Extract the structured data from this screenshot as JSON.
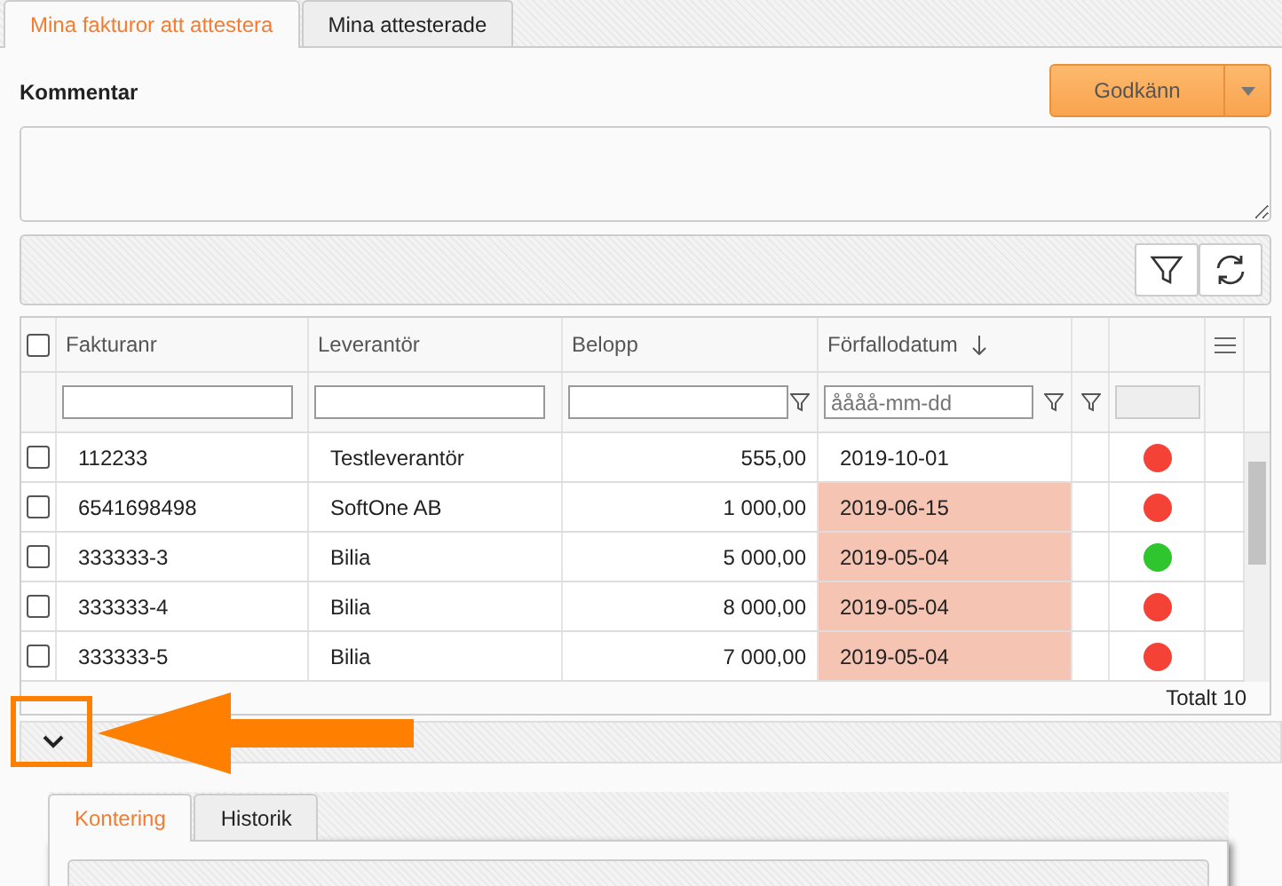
{
  "tabs": [
    {
      "label": "Mina fakturor att attestera",
      "selected": true
    },
    {
      "label": "Mina attesterade",
      "selected": false
    }
  ],
  "comment": {
    "label": "Kommentar"
  },
  "approve_button": {
    "label": "Godkänn"
  },
  "grid": {
    "columns": [
      "Fakturanr",
      "Leverantör",
      "Belopp",
      "Förfallodatum"
    ],
    "all_checked": false,
    "date_filter": {
      "placeholder": "åååå-mm-dd"
    },
    "rows": [
      {
        "invoice": "112233",
        "supplier": "Testleverantör",
        "amount": "555,00",
        "due": "2019-10-01",
        "overdue": false,
        "color": "#f44336",
        "checked": false
      },
      {
        "invoice": "6541698498",
        "supplier": "SoftOne AB",
        "amount": "1 000,00",
        "due": "2019-06-15",
        "overdue": true,
        "color": "#f44336",
        "checked": false
      },
      {
        "invoice": "333333-3",
        "supplier": "Bilia",
        "amount": "5 000,00",
        "due": "2019-05-04",
        "overdue": true,
        "color": "#2ec52e",
        "checked": false
      },
      {
        "invoice": "333333-4",
        "supplier": "Bilia",
        "amount": "8 000,00",
        "due": "2019-05-04",
        "overdue": true,
        "color": "#f44336",
        "checked": false
      },
      {
        "invoice": "333333-5",
        "supplier": "Bilia",
        "amount": "7 000,00",
        "due": "2019-05-04",
        "overdue": true,
        "color": "#f44336",
        "checked": false
      }
    ],
    "total": "Totalt 10"
  },
  "detail_tabs": [
    {
      "label": "Kontering",
      "selected": true
    },
    {
      "label": "Historik",
      "selected": false
    }
  ]
}
